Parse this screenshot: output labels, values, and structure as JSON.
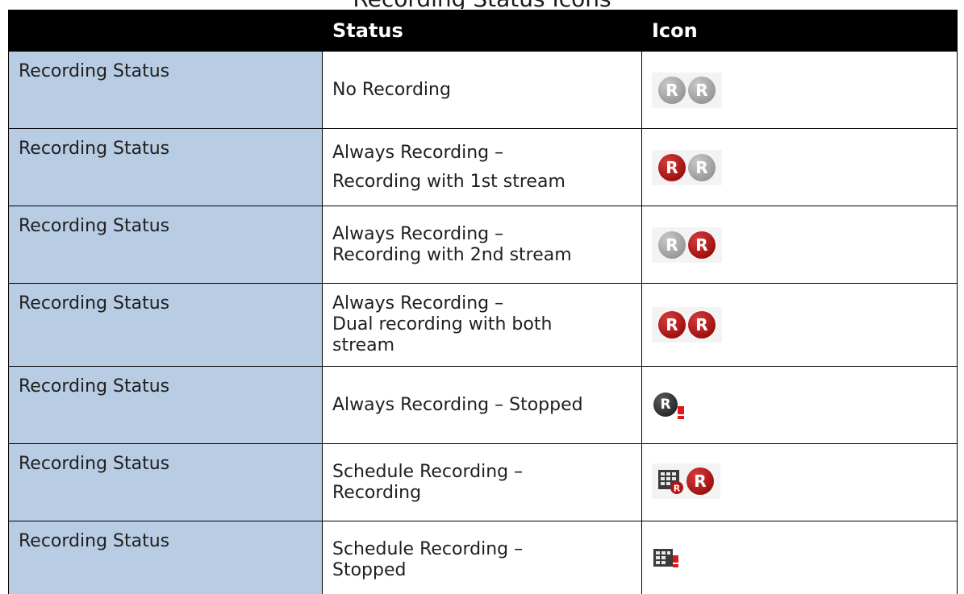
{
  "clipped_title": "Recording Status Icons",
  "table": {
    "headers": [
      "",
      "Status",
      "Icon"
    ],
    "rows": [
      {
        "category": "Recording Status",
        "status_lines": [
          "No Recording"
        ],
        "icons": [
          "r-grey",
          "r-grey"
        ]
      },
      {
        "category": "Recording Status",
        "status_lines": [
          "Always Recording –",
          "Recording with 1st stream"
        ],
        "icons": [
          "r-red",
          "r-grey"
        ]
      },
      {
        "category": "Recording Status",
        "status_lines": [
          "Always Recording –",
          "Recording with 2nd stream"
        ],
        "icons": [
          "r-grey",
          "r-red"
        ]
      },
      {
        "category": "Recording Status",
        "status_lines": [
          "Always Recording –",
          "Dual recording with both",
          "stream"
        ],
        "icons": [
          "r-red",
          "r-red"
        ]
      },
      {
        "category": "Recording Status",
        "status_lines": [
          "Always Recording – Stopped"
        ],
        "icons": [
          "r-dark-alert"
        ]
      },
      {
        "category": "Recording Status",
        "status_lines": [
          "Schedule Recording –",
          "Recording"
        ],
        "icons": [
          "schedule-recording",
          "r-red"
        ]
      },
      {
        "category": "Recording Status",
        "status_lines": [
          "Schedule Recording –",
          "Stopped"
        ],
        "icons": [
          "schedule-alert"
        ]
      }
    ]
  },
  "icon_glyph": "R",
  "colors": {
    "header_bg": "#000000",
    "header_text": "#ffffff",
    "label_cell_bg": "#b8cce4",
    "icon_red": "#a11212",
    "icon_grey": "#9a9a9a",
    "alert_red": "#e01818"
  }
}
